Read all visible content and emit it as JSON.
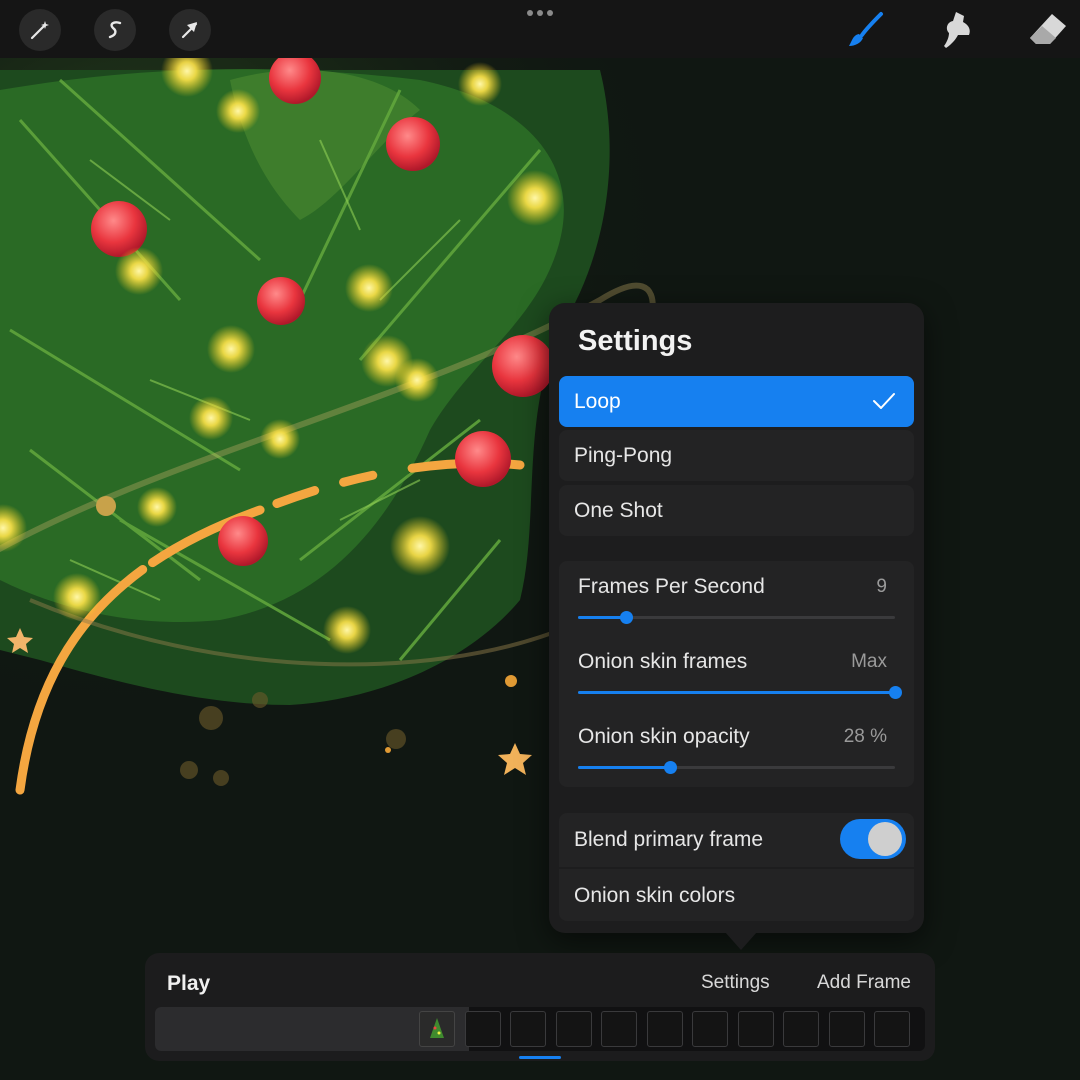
{
  "toolbar": {
    "left_tools": [
      "magic-wand-icon",
      "selection-icon",
      "transform-arrow-icon"
    ],
    "right_tools": [
      "brush-icon",
      "smudge-icon",
      "eraser-icon"
    ],
    "active_tool": "brush-icon",
    "accent_color": "#1680f0"
  },
  "settings": {
    "title": "Settings",
    "modes": [
      {
        "label": "Loop",
        "selected": true
      },
      {
        "label": "Ping-Pong",
        "selected": false
      },
      {
        "label": "One Shot",
        "selected": false
      }
    ],
    "fps": {
      "label": "Frames Per Second",
      "value": "9",
      "fraction": 0.15
    },
    "onion_frames": {
      "label": "Onion skin frames",
      "value": "Max",
      "fraction": 1.0
    },
    "onion_opacity": {
      "label": "Onion skin opacity",
      "value": "28 %",
      "fraction": 0.29
    },
    "blend_primary": {
      "label": "Blend primary frame",
      "on": true
    },
    "onion_colors": {
      "label": "Onion skin colors"
    }
  },
  "animation_bar": {
    "play": "Play",
    "settings": "Settings",
    "add_frame": "Add Frame",
    "frame_count": 11,
    "current_frame": 2
  }
}
